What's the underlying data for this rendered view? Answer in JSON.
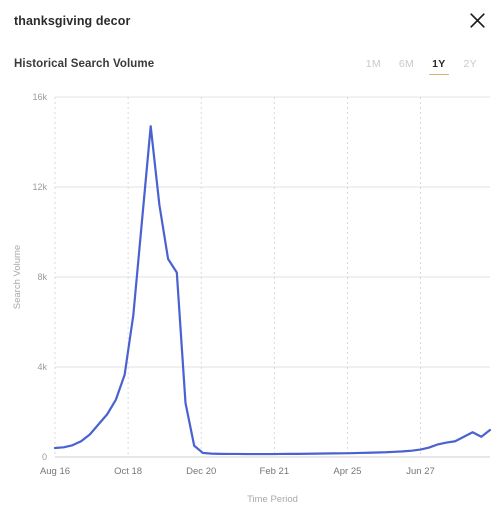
{
  "header": {
    "title": "thanksgiving decor",
    "close_icon": "close-icon"
  },
  "subheader": {
    "label": "Historical Search Volume",
    "tabs": [
      {
        "label": "1M",
        "active": false
      },
      {
        "label": "6M",
        "active": false
      },
      {
        "label": "1Y",
        "active": true
      },
      {
        "label": "2Y",
        "active": false
      }
    ],
    "active_tab": "1Y",
    "active_underline_color": "#d9b173"
  },
  "chart_data": {
    "type": "line",
    "title": "Historical Search Volume",
    "xlabel": "Time Period",
    "ylabel": "Search Volume",
    "ylim": [
      0,
      16000
    ],
    "yticks": [
      0,
      4000,
      8000,
      12000,
      16000
    ],
    "ytick_labels": [
      "0",
      "4k",
      "8k",
      "12k",
      "16k"
    ],
    "xtick_labels": [
      "Aug 16",
      "Oct 18",
      "Dec 20",
      "Feb 21",
      "Apr 25",
      "Jun 27"
    ],
    "grid": true,
    "legend": "none",
    "line_color": "#4a61d1",
    "series": [
      {
        "name": "Search Volume",
        "x": [
          "Aug 16",
          "Aug 23",
          "Aug 30",
          "Sep 06",
          "Sep 13",
          "Sep 20",
          "Sep 27",
          "Oct 04",
          "Oct 11",
          "Oct 18",
          "Oct 25",
          "Nov 01",
          "Nov 08",
          "Nov 15",
          "Nov 22",
          "Nov 29",
          "Dec 06",
          "Dec 13",
          "Dec 20",
          "Dec 27",
          "Jan 03",
          "Jan 10",
          "Jan 17",
          "Jan 24",
          "Jan 31",
          "Feb 07",
          "Feb 14",
          "Feb 21",
          "Feb 28",
          "Mar 07",
          "Mar 14",
          "Mar 21",
          "Mar 28",
          "Apr 04",
          "Apr 11",
          "Apr 18",
          "Apr 25",
          "May 02",
          "May 09",
          "May 16",
          "May 23",
          "May 30",
          "Jun 06",
          "Jun 13",
          "Jun 20",
          "Jun 27",
          "Jul 04",
          "Jul 11",
          "Jul 18",
          "Jul 25",
          "Aug 01"
        ],
        "values": [
          400,
          430,
          520,
          700,
          1000,
          1450,
          1900,
          2550,
          3650,
          6300,
          10500,
          14700,
          11200,
          8800,
          8200,
          2400,
          500,
          180,
          150,
          140,
          135,
          135,
          130,
          130,
          130,
          130,
          135,
          140,
          140,
          145,
          150,
          155,
          160,
          165,
          170,
          180,
          190,
          200,
          210,
          230,
          250,
          280,
          330,
          420,
          560,
          640,
          700,
          900,
          1100,
          900,
          1200
        ]
      }
    ]
  }
}
